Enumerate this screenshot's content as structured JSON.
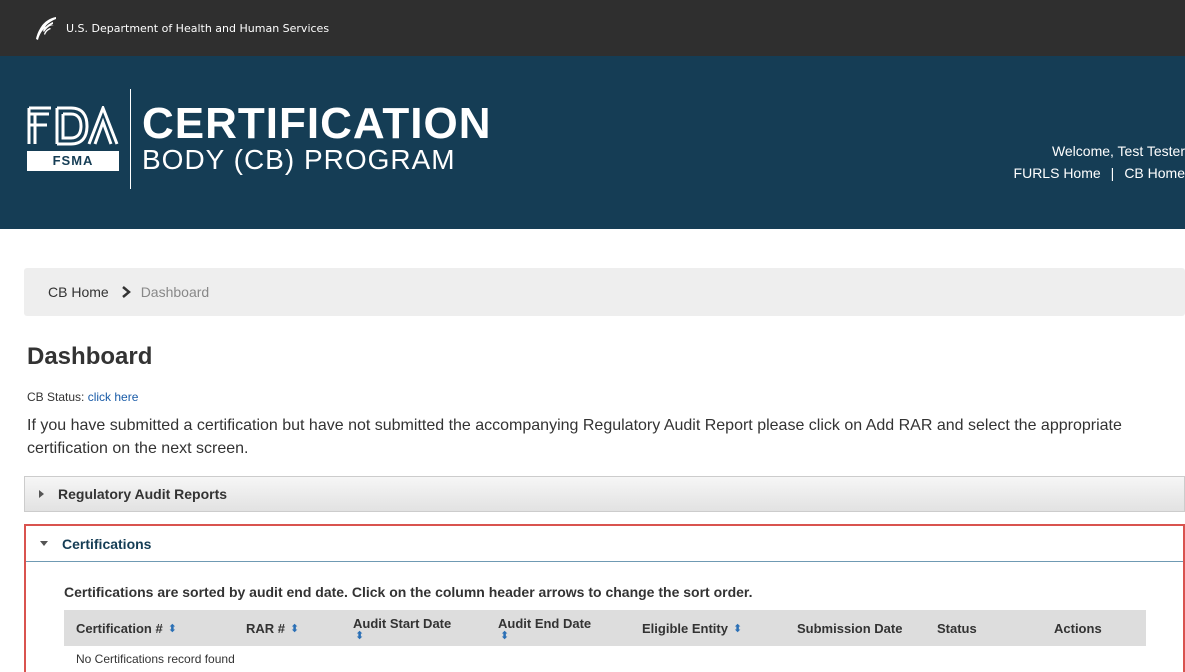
{
  "hhs_bar": {
    "text": "U.S. Department of Health and Human Services"
  },
  "banner": {
    "logo": {
      "fda": "FDA",
      "fsma": "FSMA"
    },
    "title": "CERTIFICATION",
    "subtitle": "BODY (CB) PROGRAM",
    "welcome": "Welcome, Test Tester",
    "links": {
      "furls_home": "FURLS Home",
      "separator": "|",
      "cb_home": "CB Home"
    }
  },
  "breadcrumb": {
    "home": "CB Home",
    "current": "Dashboard"
  },
  "page": {
    "title": "Dashboard",
    "cb_status_label": "CB Status:",
    "cb_status_link": "click here",
    "instructions": "If you have submitted a certification but have not submitted the accompanying Regulatory Audit Report please click on Add RAR and select the appropriate certification on the next screen."
  },
  "panels": {
    "rar": {
      "label": "Regulatory Audit Reports",
      "expanded": false
    },
    "certifications": {
      "label": "Certifications",
      "expanded": true,
      "note": "Certifications are sorted by audit end date. Click on the column header arrows to change the sort order.",
      "columns": [
        {
          "label": "Certification #",
          "sortable": true
        },
        {
          "label": "RAR #",
          "sortable": true
        },
        {
          "label": "Audit Start Date",
          "sortable": true
        },
        {
          "label": "Audit End Date",
          "sortable": true
        },
        {
          "label": "Eligible Entity",
          "sortable": true
        },
        {
          "label": "Submission Date",
          "sortable": false
        },
        {
          "label": "Status",
          "sortable": false
        },
        {
          "label": "Actions",
          "sortable": false
        }
      ],
      "empty_message": "No Certifications record found"
    }
  },
  "icons": {
    "hhs": "hhs-eagle-icon",
    "help": "help-icon",
    "print": "print-icon",
    "breadcrumb_sep": "chevron-right-icon",
    "sort": "sort-icon",
    "collapsed": "triangle-right-icon",
    "expanded": "triangle-down-icon"
  },
  "colors": {
    "header_dark": "#2f2f2f",
    "banner": "#153d55",
    "help_red": "#d9141c",
    "highlight_border": "#d9534f",
    "link": "#1a5ca8",
    "sort_arrow": "#2a6fb5"
  }
}
